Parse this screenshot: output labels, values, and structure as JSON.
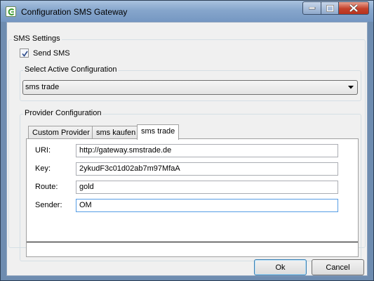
{
  "window": {
    "title": "Configuration SMS Gateway"
  },
  "sms_settings": {
    "group_label": "SMS Settings",
    "send_sms_label": "Send SMS",
    "send_sms_checked": true
  },
  "active_config": {
    "group_label": "Select Active Configuration",
    "selected": "sms trade"
  },
  "provider": {
    "group_label": "Provider Configuration",
    "tabs": [
      "Custom Provider",
      "sms kaufen",
      "sms trade"
    ],
    "active_tab": "sms trade",
    "fields": [
      {
        "label": "URI:",
        "value": "http://gateway.smstrade.de"
      },
      {
        "label": "Key:",
        "value": "2ykudF3c01d02ab7m97MfaA"
      },
      {
        "label": "Route:",
        "value": "gold"
      },
      {
        "label": "Sender:",
        "value": "OM"
      }
    ]
  },
  "buttons": {
    "ok": "Ok",
    "cancel": "Cancel"
  }
}
